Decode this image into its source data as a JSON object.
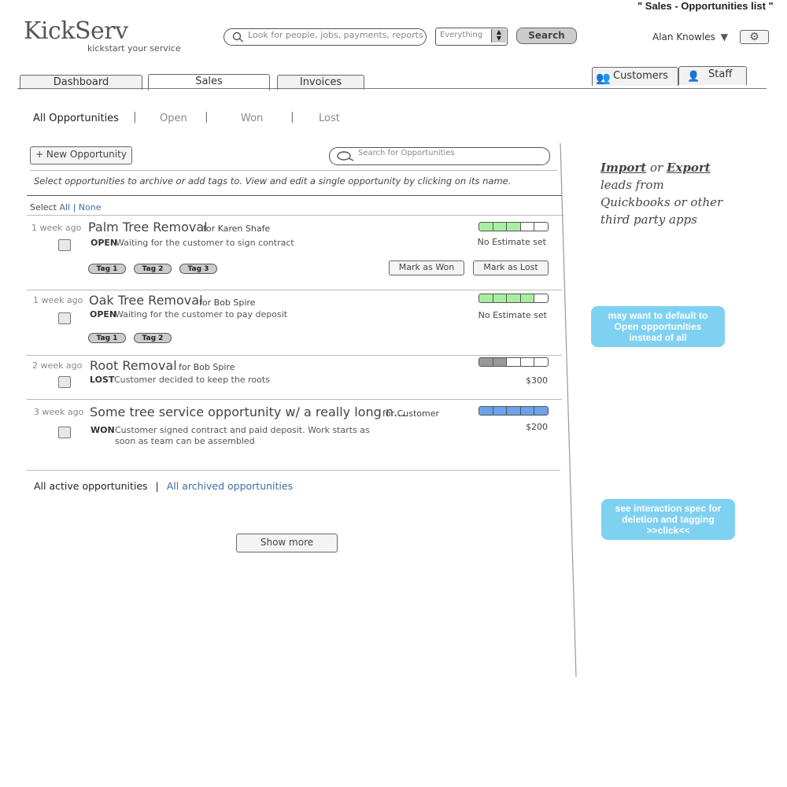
{
  "page_caption": "\" Sales - Opportunities list \"",
  "brand": {
    "name": "KickServ",
    "tagline": "kickstart your service"
  },
  "search": {
    "placeholder": "Look for people, jobs, payments, reports",
    "scope": "Everything",
    "button": "Search"
  },
  "user": {
    "name": "Alan Knowles"
  },
  "tabs": {
    "dashboard": "Dashboard",
    "sales": "Sales",
    "invoices": "Invoices",
    "customers": "Customers",
    "staff": "Staff"
  },
  "filters": {
    "all": "All Opportunities",
    "open": "Open",
    "won": "Won",
    "lost": "Lost",
    "separator": "|"
  },
  "toolbar": {
    "new_button": "+ New Opportunity",
    "search_placeholder": "Search for Opportunities"
  },
  "instructions": "Select opportunities to archive or add tags to. View and edit a single opportunity by clicking on its name.",
  "select": {
    "label": "Select",
    "all": "All",
    "divider": "|",
    "none": "None"
  },
  "opportunities": [
    {
      "ago": "1 week ago",
      "title": "Palm Tree Removal",
      "customer": "for Karen Shafe",
      "status": "OPEN",
      "description": "Waiting for the customer to sign contract",
      "estimate": "No Estimate set",
      "tags": [
        "Tag 1",
        "Tag 2",
        "Tag 3"
      ],
      "progress_filled": 3,
      "progress_color": "#a8eea0",
      "actions": {
        "won": "Mark as Won",
        "lost": "Mark as Lost"
      }
    },
    {
      "ago": "1 week ago",
      "title": "Oak Tree Removal",
      "customer": "for Bob Spire",
      "status": "OPEN",
      "description": "Waiting for the customer to pay deposit",
      "estimate": "No Estimate set",
      "tags": [
        "Tag 1",
        "Tag 2"
      ],
      "progress_filled": 4,
      "progress_color": "#a8eea0"
    },
    {
      "ago": "2 week ago",
      "title": "Root Removal",
      "customer": "for Bob Spire",
      "status": "LOST",
      "description": "Customer decided to keep the roots",
      "estimate": "$300",
      "progress_filled": 2,
      "progress_color": "#999999"
    },
    {
      "ago": "3 week ago",
      "title": "Some tree service opportunity w/ a really long n...",
      "customer": "for Customer",
      "status": "WON",
      "description_1": "Customer signed contract and paid deposit. Work starts as",
      "description_2": "soon as team can be assembled",
      "estimate": "$200",
      "progress_filled": 5,
      "progress_color": "#6aa2ec"
    }
  ],
  "footer": {
    "active": "All active opportunities",
    "separator": "|",
    "archived": "All archived opportunities",
    "show_more": "Show more"
  },
  "sidebar": {
    "import": "Import",
    "or": "or",
    "export": "Export",
    "line2": "leads from",
    "line3": "Quickbooks or other",
    "line4": "third party apps"
  },
  "notes": {
    "default_1": "may want to default to",
    "default_2": "Open opportunities",
    "default_3": "instead of all",
    "spec_1": "see interaction spec for",
    "spec_2": "deletion and tagging",
    "spec_3": ">>click<<"
  }
}
